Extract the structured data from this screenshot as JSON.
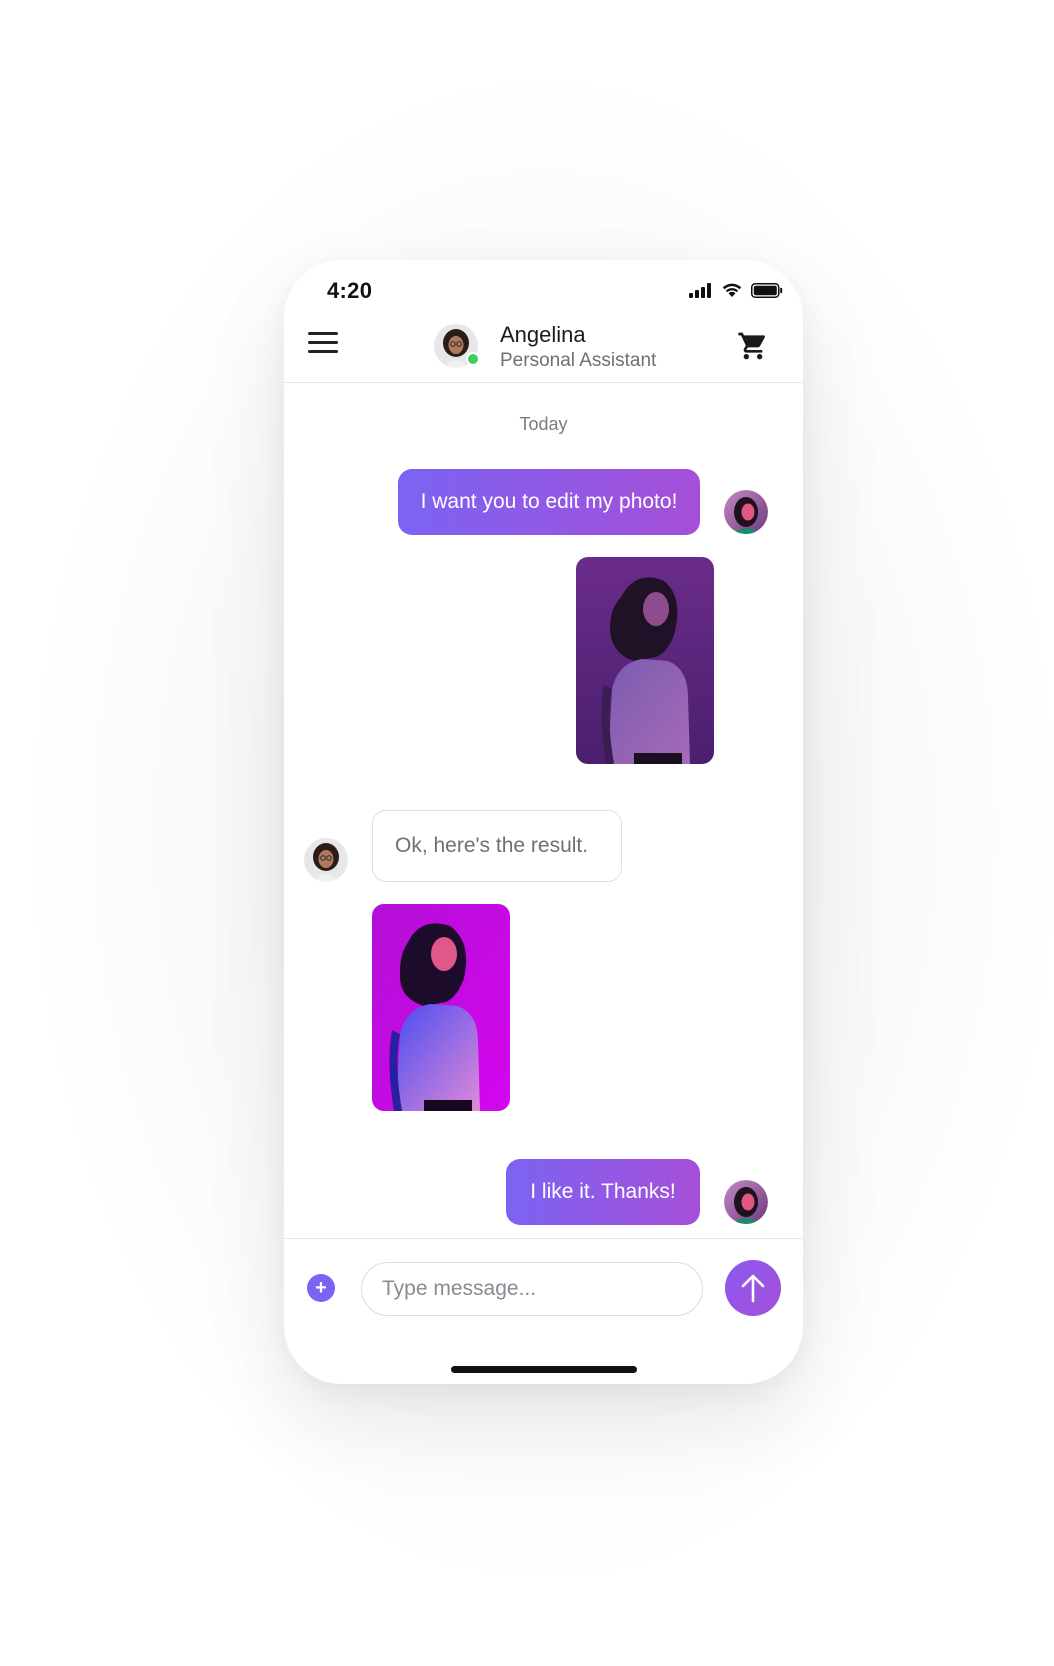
{
  "status_bar": {
    "time": "4:20",
    "icons": [
      "signal-icon",
      "wifi-icon",
      "battery-icon"
    ]
  },
  "header": {
    "menu_icon": "hamburger-menu-icon",
    "contact_name": "Angelina",
    "contact_role": "Personal Assistant",
    "online": true,
    "cart_icon": "shopping-cart-icon"
  },
  "chat": {
    "date_label": "Today",
    "messages": [
      {
        "from": "user",
        "type": "text",
        "text": "I want you to edit my photo!"
      },
      {
        "from": "user",
        "type": "image",
        "image": "original-photo"
      },
      {
        "from": "assistant",
        "type": "text",
        "text": "Ok, here's the result."
      },
      {
        "from": "assistant",
        "type": "image",
        "image": "edited-photo"
      },
      {
        "from": "user",
        "type": "text",
        "text": "I like it. Thanks!"
      }
    ]
  },
  "composer": {
    "placeholder": "Type message...",
    "attach_icon": "plus-icon",
    "send_icon": "arrow-up-icon"
  },
  "colors": {
    "accent_start": "#7c63f2",
    "accent_end": "#a54fd8",
    "online": "#3ecf5a"
  }
}
